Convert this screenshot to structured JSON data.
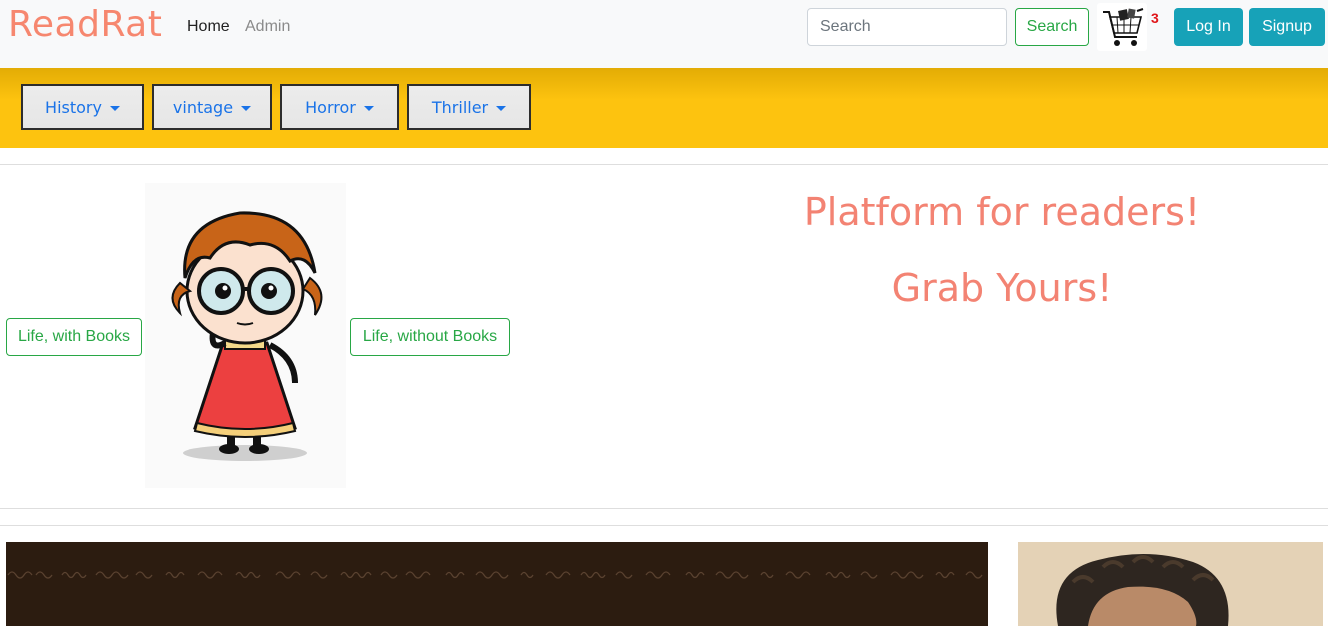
{
  "navbar": {
    "brand": "ReadRat",
    "links": [
      "Home",
      "Admin"
    ],
    "search": {
      "placeholder": "Search",
      "button": "Search"
    },
    "cart": {
      "icon": "shopping-cart-icon",
      "count": "3"
    },
    "login": "Log In",
    "signup": "Signup",
    "colors": {
      "brand": "#f6876f",
      "info": "#17a2b8",
      "success": "#28a745",
      "genre_bar": "#fdc30f"
    }
  },
  "genres": [
    "History",
    "vintage",
    "Horror",
    "Thriller"
  ],
  "hero": {
    "button_left": "Life, with Books",
    "button_right": "Life, without Books",
    "headline_1": "Platform for readers!",
    "headline_2": "Grab Yours!"
  }
}
